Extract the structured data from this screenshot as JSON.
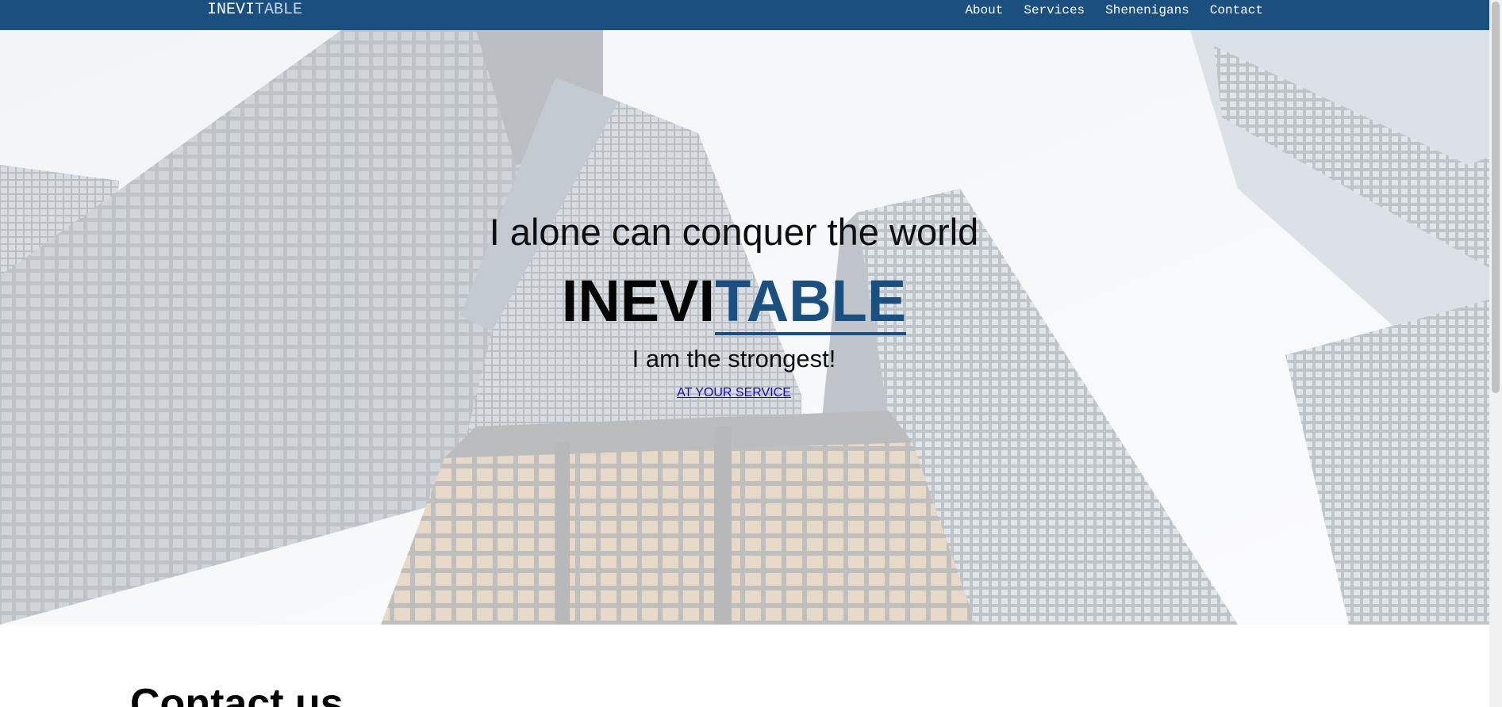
{
  "navbar": {
    "brand_part1": "INEVI",
    "brand_part2": "TABLE",
    "links": [
      "About",
      "Services",
      "Shenenigans",
      "Contact"
    ]
  },
  "hero": {
    "tagline": "I alone can conquer the world",
    "title_part1": "INEVI",
    "title_part2": "TABLE",
    "subtitle": "I am the strongest!",
    "cta_label": "AT YOUR SERVICE"
  },
  "contact": {
    "heading": "Contact us"
  },
  "colors": {
    "navbar_bg": "#1b4f80",
    "accent": "#1b4f80",
    "link": "#1a0dab"
  },
  "icons": {
    "background": "skyscrapers-photo"
  }
}
